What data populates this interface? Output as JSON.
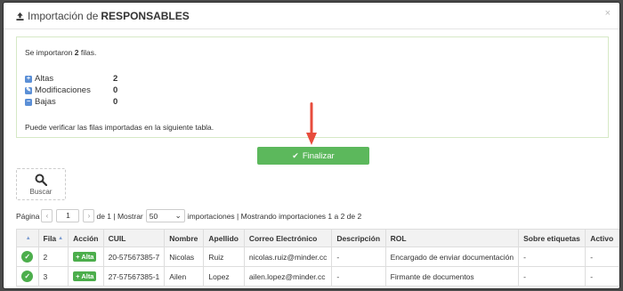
{
  "header": {
    "title_prefix": "Importación de",
    "title_bold": "RESPONSABLES",
    "close": "×"
  },
  "result": {
    "imported_prefix": "Se importaron",
    "imported_count": "2",
    "imported_suffix": "filas.",
    "stats": [
      {
        "icon": "plus-square-icon",
        "label": "Altas",
        "value": "2",
        "color": "#5b8fd6"
      },
      {
        "icon": "edit-square-icon",
        "label": "Modificaciones",
        "value": "0",
        "color": "#5b8fd6"
      },
      {
        "icon": "minus-square-icon",
        "label": "Bajas",
        "value": "0",
        "color": "#5b8fd6"
      }
    ],
    "note": "Puede verificar las filas importadas en la siguiente tabla."
  },
  "actions": {
    "finalizar_label": "Finalizar",
    "buscar_label": "Buscar"
  },
  "pager": {
    "page_label": "Página",
    "page_value": "1",
    "of_label": "de 1 | Mostrar",
    "page_size": "50",
    "summary": "importaciones | Mostrando importaciones 1 a 2 de 2"
  },
  "table": {
    "columns": [
      "",
      "Fila",
      "Acción",
      "CUIL",
      "Nombre",
      "Apellido",
      "Correo Electrónico",
      "Descripción",
      "ROL",
      "Sobre etiquetas",
      "Activo"
    ],
    "rows": [
      {
        "fila": "2",
        "accion": "Alta",
        "cuil": "20-57567385-7",
        "nombre": "Nicolas",
        "apellido": "Ruiz",
        "correo": "nicolas.ruiz@minder.cc",
        "descripcion": "-",
        "rol": "Encargado de enviar documentación",
        "etiquetas": "-",
        "activo": "-"
      },
      {
        "fila": "3",
        "accion": "Alta",
        "cuil": "27-57567385-1",
        "nombre": "Ailen",
        "apellido": "Lopez",
        "correo": "ailen.lopez@minder.cc",
        "descripcion": "-",
        "rol": "Firmante de documentos",
        "etiquetas": "-",
        "activo": "-"
      }
    ]
  },
  "colors": {
    "success": "#5cb85c",
    "annotation_arrow": "#e74c3c",
    "info_icon": "#5b8fd6"
  }
}
